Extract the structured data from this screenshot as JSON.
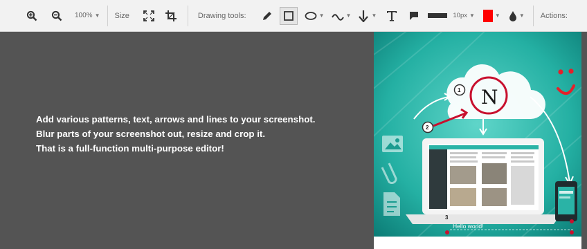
{
  "toolbar": {
    "zoom_value": "100%",
    "size_label": "Size",
    "drawing_tools_label": "Drawing tools:",
    "stroke_width": "10px",
    "actions_label": "Actions:",
    "fill_color": "#ff0000",
    "icons": [
      "zoom-in-icon",
      "zoom-out-icon",
      "resize-icon",
      "crop-icon",
      "pencil-icon",
      "rectangle-icon",
      "ellipse-icon",
      "line-icon",
      "arrow-icon",
      "text-icon",
      "speech-bubble-icon",
      "stroke-width-icon",
      "color-swatch",
      "blur-icon"
    ]
  },
  "canvas": {
    "description_lines": [
      "Add various patterns, text, arrows and lines to your screenshot.",
      "Blur parts of your screenshot out, resize and crop it.",
      "That is a full-function multi-purpose editor!"
    ]
  },
  "preview": {
    "logo_letter": "N",
    "markers": [
      "1",
      "2",
      "3"
    ],
    "hello_text": "Hello world!"
  }
}
